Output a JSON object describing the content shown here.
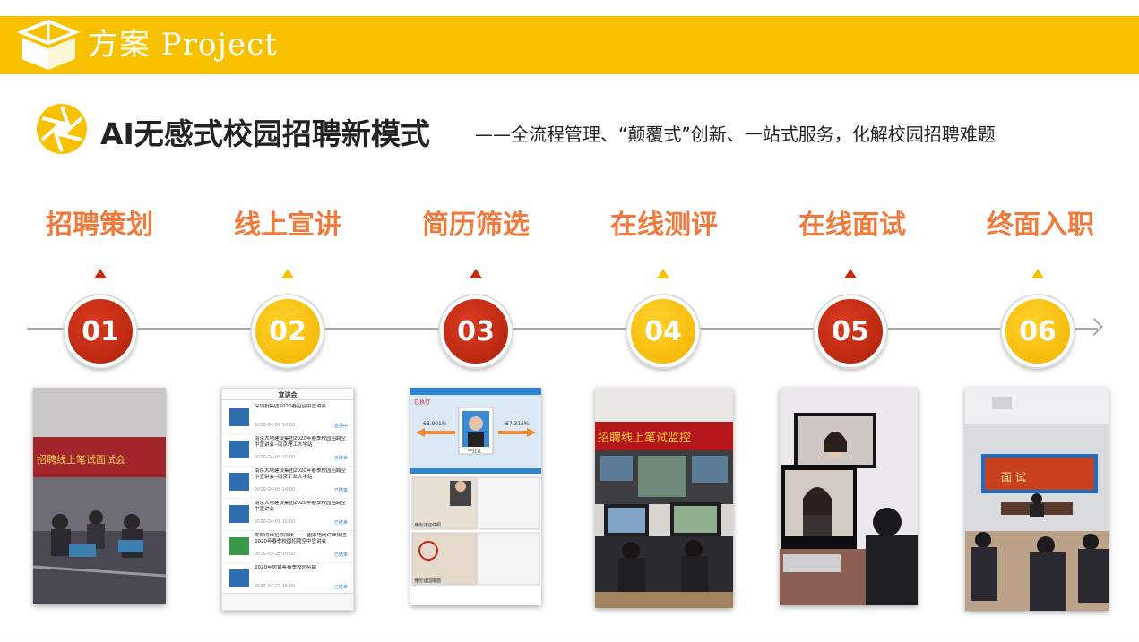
{
  "header": {
    "title": "方案 Project",
    "bg_color": "#f7c100",
    "logo_icon": "box-logo-icon"
  },
  "section": {
    "icon": "aperture-icon",
    "title": "AI无感式校园招聘新模式",
    "subtitle": "——全流程管理、“颠覆式”创新、一站式服务，化解校园招聘难题"
  },
  "colors": {
    "accent_red": "#c32a10",
    "accent_yellow": "#f7c100",
    "label_orange": "#ef7a3c"
  },
  "steps": [
    {
      "number": "01",
      "label": "招聘策划",
      "color": "red"
    },
    {
      "number": "02",
      "label": "线上宣讲",
      "color": "yellow"
    },
    {
      "number": "03",
      "label": "简历筛选",
      "color": "red"
    },
    {
      "number": "04",
      "label": "在线测评",
      "color": "yellow"
    },
    {
      "number": "05",
      "label": "在线面试",
      "color": "red"
    },
    {
      "number": "06",
      "label": "终面入职",
      "color": "yellow"
    }
  ],
  "photos": {
    "p1": {
      "banner": "招聘线上笔试面试会"
    },
    "p2": {
      "title": "宣讲会",
      "items": [
        {
          "text": "深圳投集团2020春招空中宣讲会",
          "date": "2020-04-09 14:00",
          "status": "直播中"
        },
        {
          "text": "南京大地建设集团2020年春季校园招聘空中宣讲会--南京理工大学站",
          "date": "2020-04-03 15:00",
          "status": "已结束"
        },
        {
          "text": "南京大地建设集团2020年春季校园招聘空中宣讲会--南京工业大学站",
          "date": "2020-04-03 14:00",
          "status": "已结束"
        },
        {
          "text": "南京大地建设集团2020年春季校园招聘空中宣讲会",
          "date": "2020-04-01 15:00",
          "status": "已结束"
        },
        {
          "text": "筹你而来招你而来 —— 国家电网许继集团2020年春季校园招聘空中宣讲会",
          "date": "2020-03-28 10:00",
          "status": "已结束"
        },
        {
          "text": "2020年房银客春季校园招聘",
          "date": "2020-03-27 15:00",
          "status": "已结束"
        }
      ]
    },
    "p3": {
      "left_pct": "68.991%",
      "right_pct": "67.315%",
      "photo_label": "毕业证",
      "id_front": "身份证证件照",
      "id_back": "身份证国徽面"
    },
    "p4": {
      "banner": "招聘线上笔试监控"
    },
    "p6": {
      "screen_text": "面 试"
    }
  }
}
